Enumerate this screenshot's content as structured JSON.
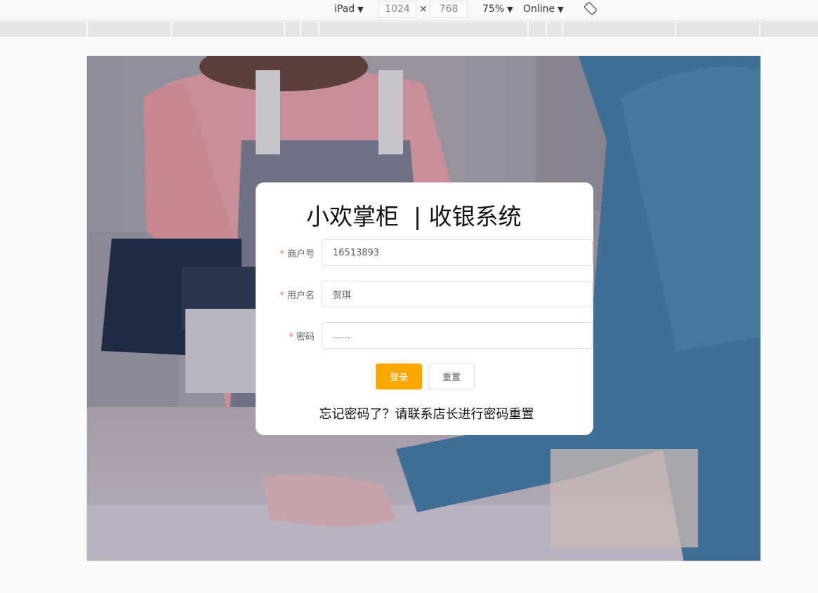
{
  "devtools": {
    "device": "iPad",
    "width": "1024",
    "height": "768",
    "times": "×",
    "zoom": "75%",
    "network": "Online",
    "dropdown_arrow": "▼"
  },
  "app": {
    "title": "小欢掌柜  | 收银系统",
    "fields": [
      {
        "label": "商户号",
        "value": "16513893",
        "type": "text"
      },
      {
        "label": "用户名",
        "value": "贺琪",
        "type": "text"
      },
      {
        "label": "密码",
        "value": "......",
        "type": "password"
      }
    ],
    "required_mark": "*",
    "login_button": "登录",
    "reset_button": "重置",
    "forgot_text": "忘记密码了？请联系店长进行密码重置"
  },
  "icons": {
    "rotate": "rotate-icon"
  },
  "colors": {
    "accent": "#ffa500",
    "required": "#f56c6c",
    "label": "#606266",
    "card_bg": "#ffffff"
  }
}
